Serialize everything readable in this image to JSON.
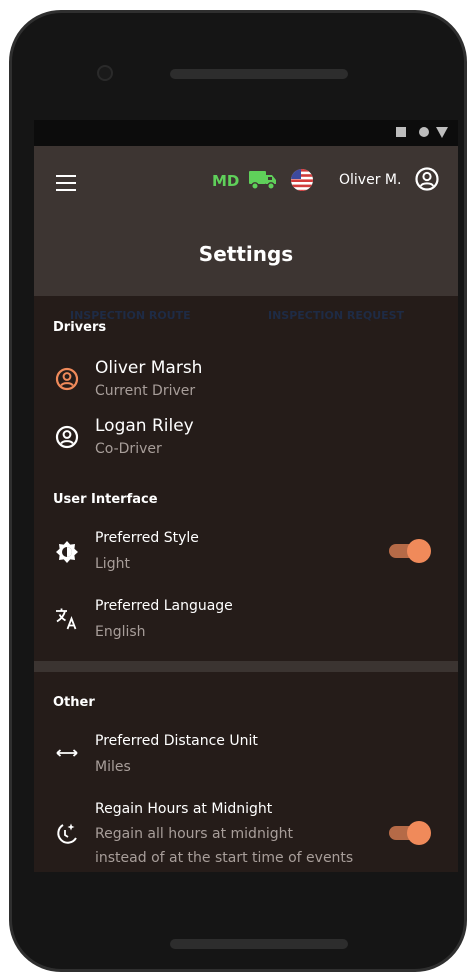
{
  "header": {
    "state_badge": "MD",
    "user_name": "Oliver M.",
    "title": "Settings"
  },
  "tabs": {
    "tab_1": "INSPECTION ROUTE",
    "tab_2": "INSPECTION REQUEST"
  },
  "drivers": {
    "section_label": "Drivers",
    "items": [
      {
        "name": "Oliver Marsh",
        "role": "Current Driver"
      },
      {
        "name": "Logan Riley",
        "role": "Co-Driver"
      }
    ]
  },
  "user_interface": {
    "section_label": "User Interface",
    "preferred_style": {
      "label": "Preferred Style",
      "value": "Light",
      "toggle_on": true
    },
    "preferred_language": {
      "label": "Preferred Language",
      "value": "English"
    }
  },
  "other": {
    "section_label": "Other",
    "distance_unit": {
      "label": "Preferred Distance Unit",
      "value": "Miles"
    },
    "regain_hours": {
      "label": "Regain Hours at Midnight",
      "description_line1": "Regain all hours at midnight",
      "description_line2": "instead of at the start time of events",
      "toggle_on": true
    }
  },
  "icons": {
    "menu": "hamburger-icon",
    "truck": "truck-icon",
    "flag": "us-flag-icon",
    "avatar": "account-circle-icon",
    "current_driver": "account-circle-icon",
    "co_driver": "account-circle-icon",
    "style": "brightness-icon",
    "language": "translate-icon",
    "distance": "arrow-left-right-icon",
    "regain": "night-clock-icon"
  },
  "colors": {
    "accent": "#f08a5a",
    "current_driver_icon": "#f08a5a",
    "state_badge": "#5fd05a",
    "truck": "#5fd05a",
    "appbar": "#3d3532",
    "screen_bg": "#251c19"
  }
}
